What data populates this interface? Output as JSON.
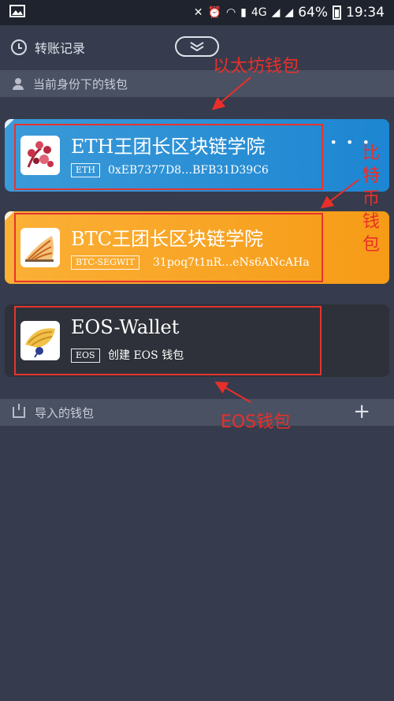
{
  "status_bar": {
    "battery": "64%",
    "time": "19:34",
    "network": "4G"
  },
  "header": {
    "history_label": "转账记录"
  },
  "section_current": {
    "label": "当前身份下的钱包"
  },
  "wallets": [
    {
      "name": "ETH王团长区块链学院",
      "tag": "ETH",
      "address": "0xEB7377D8…BFB31D39C6",
      "color": "#2a90d5"
    },
    {
      "name": "BTC王团长区块链学院",
      "tag": "BTC-SEGWIT",
      "address": "31poq7t1nR…eNs6ANcAHa",
      "color": "#f8a326"
    },
    {
      "name": "EOS-Wallet",
      "tag": "EOS",
      "address": "创建 EOS 钱包",
      "color": "#2e3139"
    }
  ],
  "section_import": {
    "label": "导入的钱包"
  },
  "annotations": {
    "eth": "以太坊钱包",
    "btc": [
      "比",
      "特",
      "币",
      "钱",
      "包"
    ],
    "eos": "EOS钱包"
  },
  "more_label": "• • •"
}
